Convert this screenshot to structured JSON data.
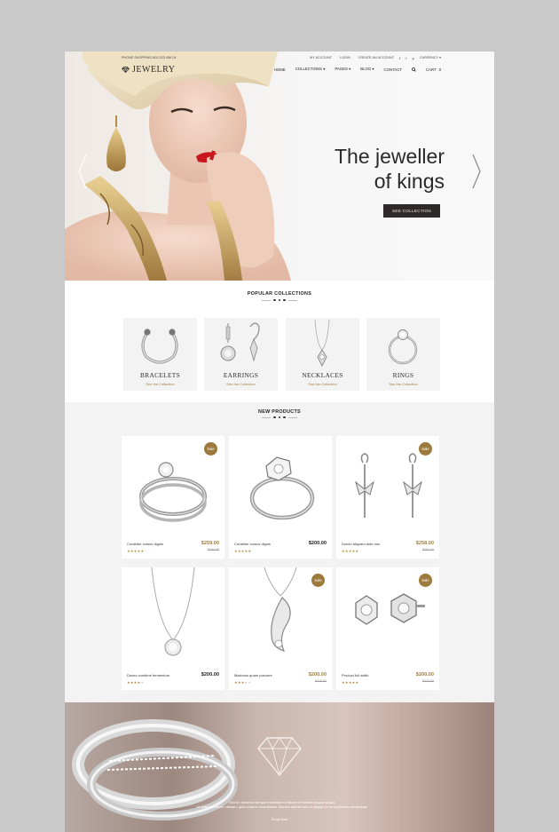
{
  "topbar": {
    "phone": "PHONE SHOPPING 800 323 456 04",
    "my_account": "MY ACCOUNT",
    "login": "LOGIN",
    "create_account": "CREATE AN ACCOUNT",
    "social": [
      "f",
      "t",
      "p"
    ],
    "currency": "CURRENCY ▾"
  },
  "navbar": {
    "logo": "JEWELRY",
    "items": [
      "HOME",
      "COLLECTIONS ▾",
      "PAGES ▾",
      "BLOG ▾",
      "CONTACT"
    ],
    "cart_label": "CART",
    "cart_count": "0"
  },
  "hero": {
    "title_line1": "The jeweller",
    "title_line2": "of kings",
    "button": "SEE COLLECTION"
  },
  "collections": {
    "title": "POPULAR COLLECTIONS",
    "items": [
      {
        "name": "BRACELETS",
        "link": "See the Collection"
      },
      {
        "name": "EARRINGS",
        "link": "See the Collection"
      },
      {
        "name": "NECKLACES",
        "link": "See the Collection"
      },
      {
        "name": "RINGS",
        "link": "See the Collection"
      }
    ]
  },
  "new_products": {
    "title": "NEW PRODUCTS",
    "badge": "Sale",
    "items": [
      {
        "name": "Curabitur cursus dignis",
        "price": "$259.00",
        "old_price": "$280.00",
        "sale": true,
        "rating": 5
      },
      {
        "name": "Curabitur cursus dignis",
        "price": "$200.00",
        "old_price": "",
        "sale": false,
        "rating": 5
      },
      {
        "name": "Donec aliquam ante non",
        "price": "$258.00",
        "old_price": "$280.00",
        "sale": true,
        "rating": 5
      },
      {
        "name": "Donec condime fermentum",
        "price": "$200.00",
        "old_price": "",
        "sale": false,
        "rating": 4
      },
      {
        "name": "Maximus quam posuere",
        "price": "$200.00",
        "old_price": "$220.00",
        "sale": true,
        "rating": 3
      },
      {
        "name": "Product full width",
        "price": "$200.00",
        "old_price": "$220.00",
        "sale": true,
        "rating": 5
      }
    ]
  },
  "banner": {
    "line1": "Sed do eiusmod tempor incididunt ut labore et dolore magna aliqua.",
    "line2": "Ut enim ad minim veniam, quis nostrud exercitation ullamco laboris nisi ut aliquip ex ea commodo consequat.",
    "link": "Shop Now"
  },
  "colors": {
    "accent_gold": "#9c7a3c",
    "dark_button": "#2e2a29",
    "page_bg": "#c9c9c9"
  }
}
